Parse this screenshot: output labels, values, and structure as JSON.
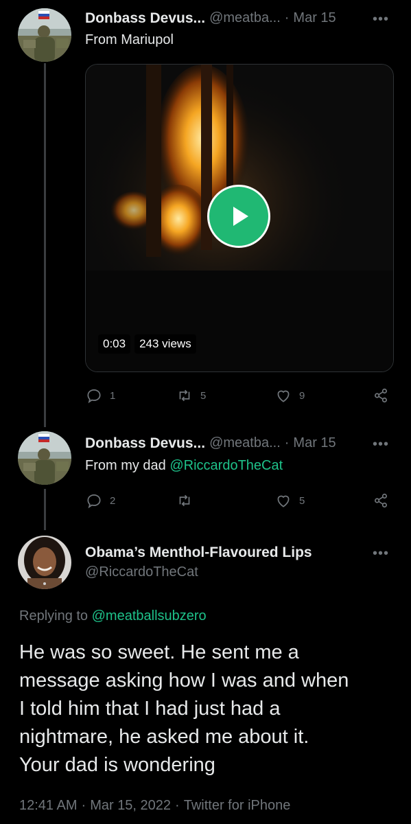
{
  "tweet1": {
    "name": "Donbass Devus...",
    "handle": "@meatba...",
    "dot": "·",
    "date": "Mar 15",
    "text": "From Mariupol",
    "video": {
      "duration": "0:03",
      "views": "243 views"
    },
    "actions": {
      "replies": "1",
      "retweets": "5",
      "likes": "9"
    }
  },
  "tweet2": {
    "name": "Donbass Devus...",
    "handle": "@meatba...",
    "dot": "·",
    "date": "Mar 15",
    "text_prefix": "From my dad ",
    "mention": "@RiccardoTheCat",
    "actions": {
      "replies": "2",
      "retweets": "",
      "likes": "5"
    }
  },
  "tweet3": {
    "name": "Obama’s Menthol-Flavoured Lips",
    "handle": "@RiccardoTheCat",
    "replying_prefix": "Replying to ",
    "replying_to": "@meatballsubzero",
    "text_lines": [
      "He was so sweet. He sent me a",
      "message asking how I was and when",
      "I told him that I had just had a",
      "nightmare, he asked me about it.",
      "Your dad is wondering"
    ],
    "time": "12:41 AM",
    "sep1": "·",
    "full_date": "Mar 15, 2022",
    "sep2": "·",
    "client": "Twitter for iPhone"
  },
  "more_label": "•••",
  "colors": {
    "accent": "#1ec28a",
    "play": "#20b873",
    "muted": "#71767b",
    "background": "#000000"
  }
}
